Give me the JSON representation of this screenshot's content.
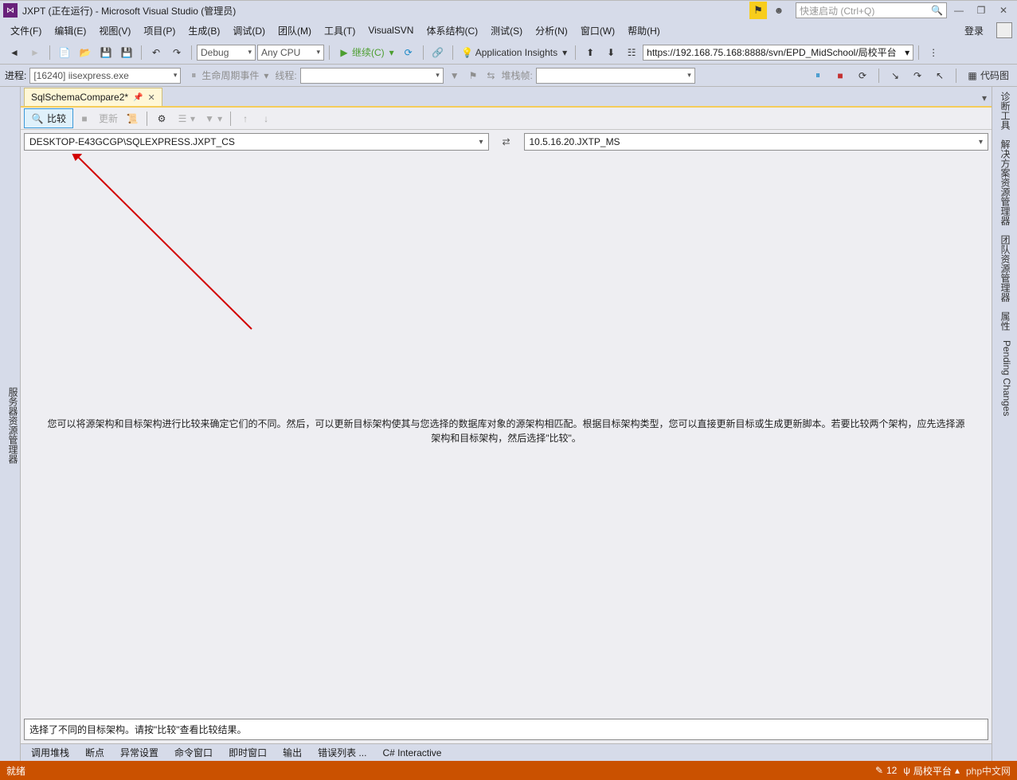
{
  "title_bar": {
    "title": "JXPT (正在运行) - Microsoft Visual Studio (管理员)",
    "quick_launch_placeholder": "快速启动 (Ctrl+Q)"
  },
  "menu": {
    "file": "文件(F)",
    "edit": "编辑(E)",
    "view": "视图(V)",
    "project": "项目(P)",
    "build": "生成(B)",
    "debug": "调试(D)",
    "team": "团队(M)",
    "tools": "工具(T)",
    "visualsvn": "VisualSVN",
    "architecture": "体系结构(C)",
    "test": "测试(S)",
    "analyze": "分析(N)",
    "window": "窗口(W)",
    "help": "帮助(H)",
    "login": "登录"
  },
  "toolbar": {
    "config": "Debug",
    "platform": "Any CPU",
    "continue": "继续(C)",
    "app_insights": "Application Insights",
    "url": "https://192.168.75.168:8888/svn/EPD_MidSchool/局校平台",
    "code_map_btn": "代码图"
  },
  "debug_toolbar": {
    "process_label": "进程:",
    "process_value": "[16240] iisexpress.exe",
    "lifecycle": "生命周期事件",
    "thread_label": "线程:",
    "stackframe_label": "堆栈帧:"
  },
  "left_panels": {
    "server_explorer": "服务器资源管理器"
  },
  "right_panels": {
    "diag_tools": "诊断工具",
    "solution_explorer": "解决方案资源管理器",
    "team_explorer": "团队资源管理器",
    "properties": "属性",
    "pending_changes": "Pending Changes"
  },
  "doc_tab": {
    "name": "SqlSchemaCompare2*"
  },
  "compare_toolbar": {
    "compare": "比较",
    "stop": "",
    "update": "更新"
  },
  "source_db": "DESKTOP-E43GCGP\\SQLEXPRESS.JXPT_CS",
  "target_db": "10.5.16.20.JXTP_MS",
  "help_text": "您可以将源架构和目标架构进行比较来确定它们的不同。然后，可以更新目标架构使其与您选择的数据库对象的源架构相匹配。根据目标架构类型，您可以直接更新目标或生成更新脚本。若要比较两个架构，应先选择源架构和目标架构，然后选择\"比较\"。",
  "result_msg": "选择了不同的目标架构。请按\"比较\"查看比较结果。",
  "bottom_tabs": {
    "callstack": "调用堆栈",
    "breakpoints": "断点",
    "exceptions": "异常设置",
    "command": "命令窗口",
    "immediate": "即时窗口",
    "output": "输出",
    "error_list": "错误列表 ...",
    "csharp": "C# Interactive"
  },
  "status": {
    "ready": "就绪",
    "changes": "12",
    "branch": "局校平台",
    "watermark": "php中文网"
  }
}
